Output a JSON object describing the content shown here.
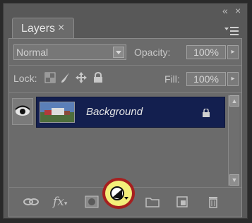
{
  "panel": {
    "tab_label": "Layers",
    "tab_close": "×"
  },
  "window": {
    "collapse": "«",
    "close": "×"
  },
  "blend": {
    "value": "Normal"
  },
  "opacity": {
    "label": "Opacity:",
    "value": "100%"
  },
  "lock": {
    "label": "Lock:"
  },
  "fill": {
    "label": "Fill:",
    "value": "100%"
  },
  "layers": [
    {
      "name": "Background",
      "visible": true,
      "locked": true,
      "selected": true
    }
  ],
  "footer": {
    "icons": [
      "link-layers-icon",
      "layer-style-fx-icon",
      "add-mask-icon",
      "new-adjustment-layer-icon",
      "new-group-folder-icon",
      "new-layer-icon",
      "delete-layer-icon"
    ],
    "highlighted": "new-adjustment-layer-icon",
    "fx_text": "fx"
  },
  "colors": {
    "selected_row": "#131f4f",
    "highlight_fill": "#f4ef7a",
    "highlight_ring": "#a61f1f"
  }
}
